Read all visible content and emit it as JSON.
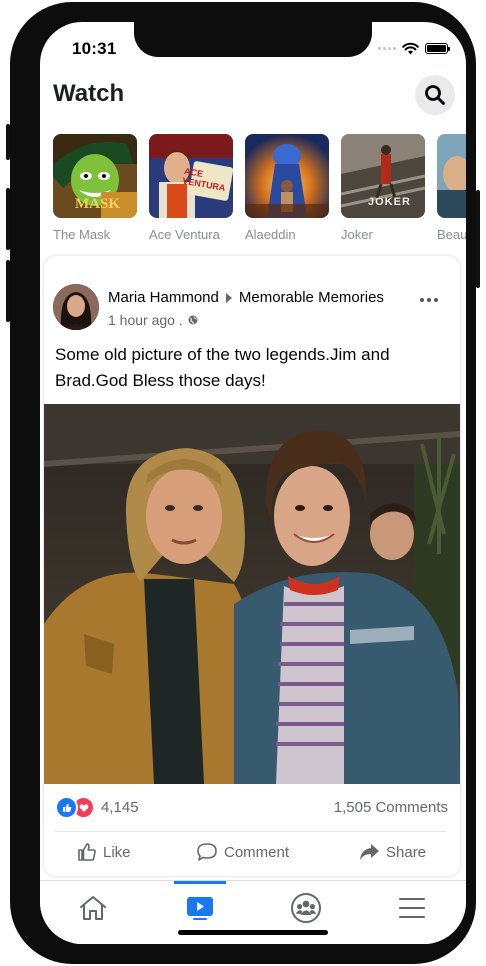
{
  "status_bar": {
    "time": "10:31"
  },
  "header": {
    "title": "Watch"
  },
  "stories": [
    {
      "label": "The Mask"
    },
    {
      "label": "Ace Ventura"
    },
    {
      "label": "Alaeddin"
    },
    {
      "label": "Joker"
    },
    {
      "label": "Beau"
    }
  ],
  "posters": {
    "mask_text": "MASK",
    "ace_text": "ACE VENTURA",
    "joker_text": "JOKER"
  },
  "post": {
    "author": "Maria Hammond",
    "group": "Memorable Memories",
    "time": "1 hour ago .",
    "text": "Some old picture of the two legends.Jim and Brad.God Bless those days!",
    "reaction_count": "4,145",
    "comments": "1,505 Comments",
    "actions": {
      "like": "Like",
      "comment": "Comment",
      "share": "Share"
    }
  },
  "tabs": [
    {
      "icon": "home-icon",
      "active": false
    },
    {
      "icon": "watch-icon",
      "active": true
    },
    {
      "icon": "groups-icon",
      "active": false
    },
    {
      "icon": "menu-icon",
      "active": false
    }
  ],
  "colors": {
    "accent": "#1877f2",
    "love": "#f33e58",
    "text_secondary": "#65676b"
  }
}
